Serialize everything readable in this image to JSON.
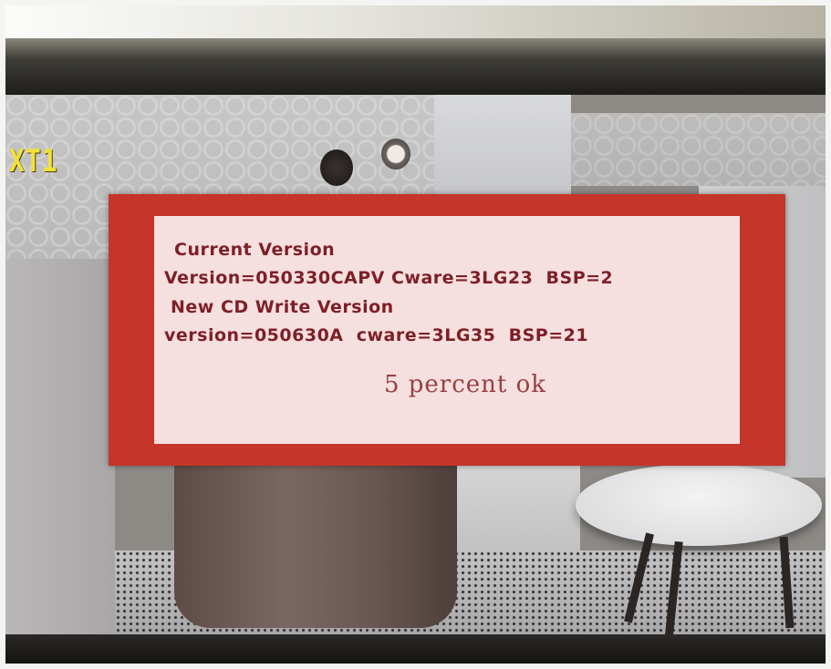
{
  "osd": {
    "channel_label": "XT1"
  },
  "update_dialog": {
    "current_version_heading": "Current Version",
    "current_version_line": "Version=050330CAPV Cware=3LG23  BSP=2",
    "new_version_heading": "New CD Write Version",
    "new_version_line": "version=050630A  cware=3LG35  BSP=21",
    "progress_text": "5 percent ok",
    "progress_percent": 5
  },
  "colors": {
    "dialog_border": "#c5352a",
    "dialog_background": "#f6dfdf",
    "dialog_text": "#7d1f26",
    "channel_label": "#f1e13b"
  }
}
